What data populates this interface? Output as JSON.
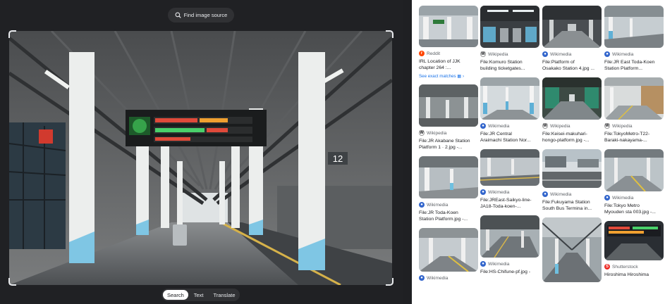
{
  "viewer": {
    "find_source_label": "Find image source",
    "modes": [
      "Search",
      "Text",
      "Translate"
    ],
    "active_mode": "Search",
    "photo_sign_number": "12",
    "accent": "#8ab4f8"
  },
  "results": {
    "see_exact_label": "See exact matches",
    "columns": [
      [
        {
          "source": "Reddit",
          "icon": "reddit-icon",
          "title": "IRL Location of JJK\nchapter 264 :...",
          "thumb": "station-interior"
        },
        {
          "source": "Wikipedia",
          "icon": "wikipedia-icon",
          "title": "File:JR Akabane Station\nPlatform 1 · 2.jpg -...",
          "thumb": "platform-roof"
        },
        {
          "source": "Wikimedia",
          "icon": "wikimedia-icon",
          "title": "File:JR Toda-Koen\nStation Platform.jpg -...",
          "thumb": "platform-open"
        },
        {
          "source": "Wikimedia",
          "icon": "wikimedia-icon",
          "title": "",
          "thumb": "platform-yellow"
        }
      ],
      [
        {
          "source": "Wikipedia",
          "icon": "wikipedia-icon",
          "title": "File:Komuro Station\nbuilding ticketgates...",
          "thumb": "ticket-gates"
        },
        {
          "source": "Wikimedia",
          "icon": "wikimedia-icon",
          "title": "File:JR Central\nAraimachi Station Nor...",
          "thumb": "platform-blue"
        },
        {
          "source": "Wikimedia",
          "icon": "wikimedia-icon",
          "title": "File:JREast-Saikyo-line-\nJA18-Toda-koen-...",
          "thumb": "platform-tracks"
        },
        {
          "source": "Wikimedia",
          "icon": "wikimedia-icon",
          "title": "File:HS-Chifune-pf.jpg -",
          "thumb": "platform-curve"
        }
      ],
      [
        {
          "source": "Wikimedia",
          "icon": "wikimedia-icon",
          "title": "File:Platform of\nOsakako Station 4.jpg ...",
          "thumb": "dark-platform"
        },
        {
          "source": "Wikipedia",
          "icon": "wikipedia-icon",
          "title": "File:Keisei-makuhari-\nhongo-platform.jpg -...",
          "thumb": "green-platform"
        },
        {
          "source": "Wikimedia",
          "icon": "wikimedia-icon",
          "title": "File:Fukuyama Station\nSouth Bus Termina in...",
          "thumb": "bus-terminal"
        },
        {
          "source": "",
          "icon": "",
          "title": "",
          "thumb": "long-platform"
        }
      ],
      [
        {
          "source": "Wikimedia",
          "icon": "wikimedia-icon",
          "title": "File:JR East Toda-Koen\nStation Platform...",
          "thumb": "platform-day"
        },
        {
          "source": "Wikipedia",
          "icon": "wikipedia-icon",
          "title": "File:TokyoMetro-T22-\nBaraki-nakayama-...",
          "thumb": "subway-platform"
        },
        {
          "source": "Wikimedia",
          "icon": "wikimedia-icon",
          "title": "File:Tokyo Metro\nMyouden sta 003.jpg -...",
          "thumb": "elevated-platform"
        },
        {
          "source": "Shutterstock",
          "icon": "shutterstock-icon",
          "title": "Hiroshima Hiroshima",
          "thumb": "display-board"
        }
      ]
    ]
  }
}
